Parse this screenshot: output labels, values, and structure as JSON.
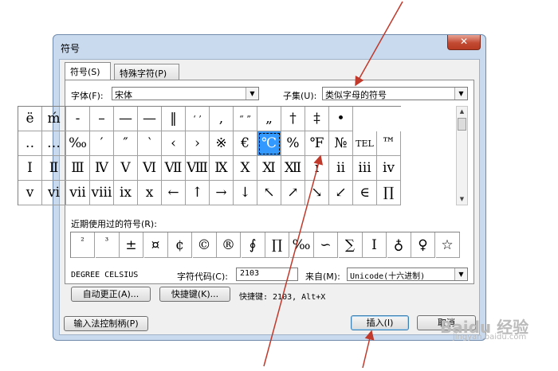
{
  "dialog": {
    "title": "符号",
    "close_label": "✕",
    "tabs": [
      "符号(S)",
      "特殊字符(P)"
    ],
    "font_label": "字体(F):",
    "font_value": "宋体",
    "subset_label": "子集(U):",
    "subset_value": "类似字母的符号",
    "symbols": [
      [
        "ë",
        "ḿ",
        "-",
        "–",
        "—",
        "—",
        "‖",
        "‘ ’",
        ",",
        "“ ”",
        "„",
        "†",
        "‡",
        "•"
      ],
      [
        "‥",
        "…",
        "‰",
        "′",
        "″",
        "‵",
        "‹",
        "›",
        "※",
        "€",
        "℃",
        "%",
        "℉",
        "№",
        "TEL",
        "™"
      ],
      [
        "Ⅰ",
        "Ⅱ",
        "Ⅲ",
        "Ⅳ",
        "Ⅴ",
        "Ⅵ",
        "Ⅶ",
        "Ⅷ",
        "Ⅸ",
        "Ⅹ",
        "Ⅺ",
        "Ⅻ",
        "ⅰ",
        "ⅱ",
        "ⅲ",
        "ⅳ"
      ],
      [
        "ⅴ",
        "ⅵ",
        "ⅶ",
        "ⅷ",
        "ⅸ",
        "ⅹ",
        "←",
        "↑",
        "→",
        "↓",
        "↖",
        "↗",
        "↘",
        "↙",
        "∈",
        "∏"
      ]
    ],
    "recent_label": "近期使用过的符号(R):",
    "recent_symbols": [
      "²",
      "³",
      "±",
      "¤",
      "¢",
      "©",
      "®",
      "∮",
      "∏",
      "‰",
      "∽",
      "∑",
      "Ⅰ",
      "♁",
      "♀",
      "☆"
    ],
    "char_name": "DEGREE CELSIUS",
    "code_label": "字符代码(C):",
    "code_value": "2103",
    "from_label": "来自(M):",
    "from_value": "Unicode(十六进制)",
    "autocorrect_btn": "自动更正(A)...",
    "shortcut_btn": "快捷键(K)...",
    "shortcut_text": "快捷键: 2103, Alt+X",
    "ime_btn": "输入法控制柄(P)",
    "insert_btn": "插入(I)",
    "cancel_btn": "取消"
  },
  "watermark": {
    "main": "Baidu 经验",
    "sub": "jingyan.baidu.com"
  },
  "colors": {
    "selection": "#3399ff",
    "annotation_arrow": "#c0392b",
    "window_frame": "#c9daef"
  },
  "selected_symbol": "℃"
}
